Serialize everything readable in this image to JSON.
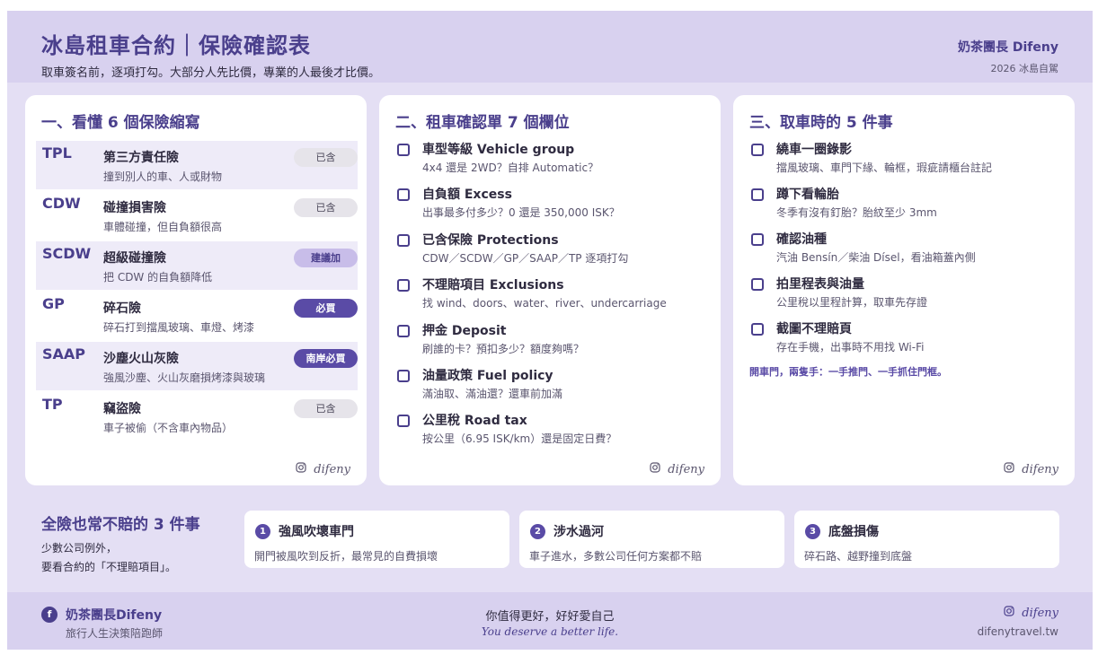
{
  "header": {
    "title": "冰島租車合約｜保險確認表",
    "subtitle": "取車簽名前，逐項打勾。大部分人先比價，專業的人最後才比價。",
    "brand": "奶茶團長 Difeny",
    "year": "2026 冰島自駕"
  },
  "insurance": {
    "title": "一、看懂 6 個保險縮寫",
    "items": [
      {
        "code": "TPL",
        "name": "第三方責任險",
        "desc": "撞到別人的車、人或財物",
        "badge": "已含"
      },
      {
        "code": "CDW",
        "name": "碰撞損害險",
        "desc": "車體碰撞，但自負額很高",
        "badge": "已含"
      },
      {
        "code": "SCDW",
        "name": "超級碰撞險",
        "desc": "把 CDW 的自負額降低",
        "badge": "建議加"
      },
      {
        "code": "GP",
        "name": "碎石險",
        "desc": "碎石打到擋風玻璃、車燈、烤漆",
        "badge": "必買"
      },
      {
        "code": "SAAP",
        "name": "沙塵火山灰險",
        "desc": "強風沙塵、火山灰磨損烤漆與玻璃",
        "badge": "南岸必買"
      },
      {
        "code": "TP",
        "name": "竊盜險",
        "desc": "車子被偷（不含車內物品）",
        "badge": "已含"
      }
    ],
    "footer": "difeny"
  },
  "contract": {
    "title": "二、租車確認單 7 個欄位",
    "items": [
      {
        "label": "車型等級 Vehicle group",
        "desc": "4x4 還是 2WD？自排 Automatic？"
      },
      {
        "label": "自負額 Excess",
        "desc": "出事最多付多少？0 還是 350,000 ISK？"
      },
      {
        "label": "已含保險 Protections",
        "desc": "CDW／SCDW／GP／SAAP／TP 逐項打勾"
      },
      {
        "label": "不理賠項目 Exclusions",
        "desc": "找 wind、doors、water、river、undercarriage"
      },
      {
        "label": "押金 Deposit",
        "desc": "刷誰的卡？預扣多少？額度夠嗎？"
      },
      {
        "label": "油量政策 Fuel policy",
        "desc": "滿油取、滿油還？還車前加滿"
      },
      {
        "label": "公里稅 Road tax",
        "desc": "按公里（6.95 ISK/km）還是固定日費？"
      }
    ],
    "footer": "difeny"
  },
  "pickup": {
    "title": "三、取車時的 5 件事",
    "items": [
      {
        "label": "繞車一圈錄影",
        "desc": "擋風玻璃、車門下緣、輪框，瑕疵請櫃台註記"
      },
      {
        "label": "蹲下看輪胎",
        "desc": "冬季有沒有釘胎？胎紋至少 3mm"
      },
      {
        "label": "確認油種",
        "desc": "汽油 Bensín／柴油 Dísel，看油箱蓋內側"
      },
      {
        "label": "拍里程表與油量",
        "desc": "公里稅以里程計算，取車先存證"
      },
      {
        "label": "截圖不理賠頁",
        "desc": "存在手機，出事時不用找 Wi-Fi"
      }
    ],
    "note": "開車門，兩隻手：一手推門、一手抓住門框。",
    "footer": "difeny"
  },
  "exclusions": {
    "title": "全險也常不賠的 3 件事",
    "sub1": "少數公司例外，",
    "sub2": "要看合約的「不理賠項目」。",
    "items": [
      {
        "num": "1",
        "title": "強風吹壞車門",
        "desc": "開門被風吹到反折，最常見的自費損壞"
      },
      {
        "num": "2",
        "title": "涉水過河",
        "desc": "車子進水，多數公司任何方案都不賠"
      },
      {
        "num": "3",
        "title": "底盤損傷",
        "desc": "碎石路、越野撞到底盤"
      }
    ]
  },
  "footer": {
    "icon_letter": "f",
    "name": "奶茶團長Difeny",
    "role": "旅行人生決策陪跑師",
    "slogan": "你值得更好，好好愛自己",
    "slogan_en": "You deserve a better life.",
    "ig": "difeny",
    "site": "difenytravel.tw"
  },
  "colors": {
    "accent": "#4a3f8c",
    "badge_dark": "#5a4ba6",
    "badge_light": "#c8bde9",
    "badge_gray": "#e6e4ea",
    "background": "#e4dff4",
    "header_band": "#d8d1ef"
  },
  "icons": {
    "instagram": "instagram-icon",
    "facebook": "facebook-icon",
    "checkbox": "checkbox-icon"
  }
}
